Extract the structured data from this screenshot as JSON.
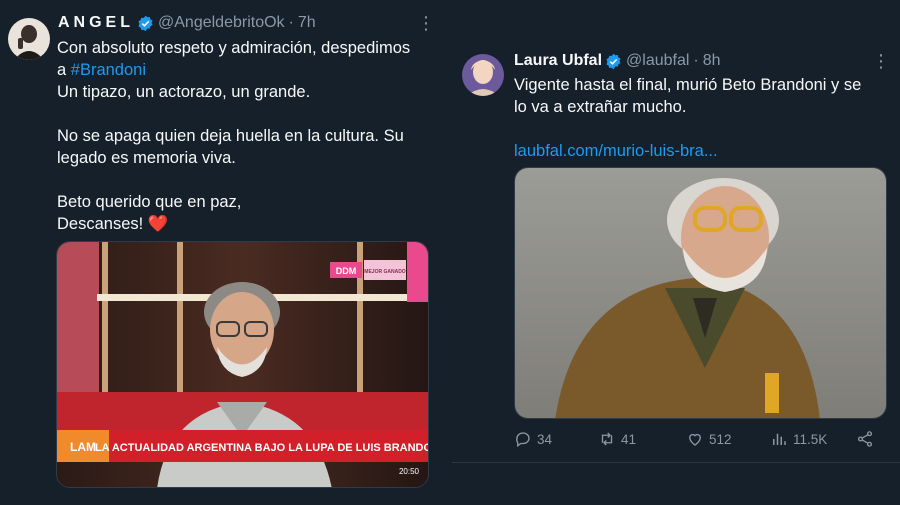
{
  "tweets": [
    {
      "name": "ANGEL",
      "handle": "@AngeldebritoOk",
      "separator": "·",
      "time": "7h",
      "text_line1": "Con absoluto respeto y admiración, despedimos",
      "text_line2_prefix": "a ",
      "hashtag": "#Brandoni",
      "text_line3": "Un tipazo, un actorazo, un grande.",
      "text_line4": "No se apaga quien deja huella en la cultura. Su",
      "text_line5": "legado es memoria viva.",
      "text_line6": "Beto querido que en paz,",
      "text_line7": "Descanses! ❤️",
      "media": {
        "tv_channel_badge": "DDM",
        "tv_show_badge": "MEJOR GANADO",
        "lower_third_logo": "LAM",
        "lower_third_caption": "LA ACTUALIDAD ARGENTINA BAJO LA LUPA DE LUIS BRANDONI",
        "tv_clock": "20:50"
      }
    },
    {
      "name": "Laura Ubfal",
      "handle": "@laubfal",
      "separator": "·",
      "time": "8h",
      "text_line1": "Vigente hasta el final, murió Beto Brandoni y se",
      "text_line2": "lo va a extrañar mucho.",
      "link": "laubfal.com/murio-luis-bra...",
      "actions": {
        "replies": "34",
        "retweets": "41",
        "likes": "512",
        "views": "11.5K"
      }
    }
  ],
  "colors": {
    "background": "#15202b",
    "accent": "#1d9bf0",
    "muted": "#8b98a5",
    "text": "#f7f9f9"
  },
  "icons": [
    "verified-badge-icon",
    "more-icon",
    "reply-icon",
    "retweet-icon",
    "like-icon",
    "views-icon",
    "share-icon"
  ]
}
